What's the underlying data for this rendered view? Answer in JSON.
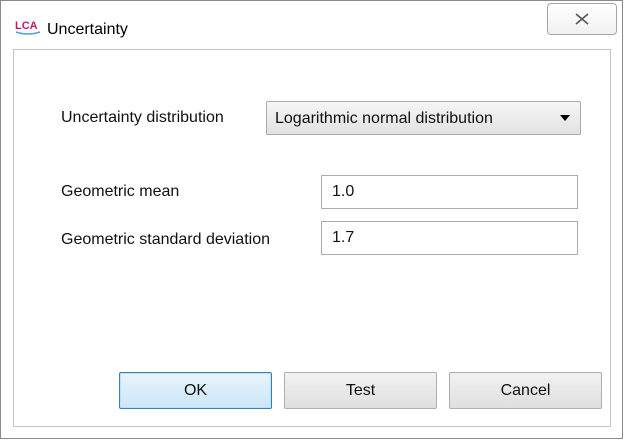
{
  "window": {
    "title": "Uncertainty",
    "app_icon": "lca-app-icon",
    "close_icon": "close-icon"
  },
  "form": {
    "distribution_label": "Uncertainty distribution",
    "distribution_value": "Logarithmic normal distribution",
    "mean_label": "Geometric mean",
    "mean_value": "1.0",
    "sd_label": "Geometric standard deviation",
    "sd_value": "1.7"
  },
  "buttons": {
    "ok": "OK",
    "test": "Test",
    "cancel": "Cancel"
  },
  "colors": {
    "icon_brand": "#c01a6b",
    "primary_button_border": "#3c7fb1"
  }
}
